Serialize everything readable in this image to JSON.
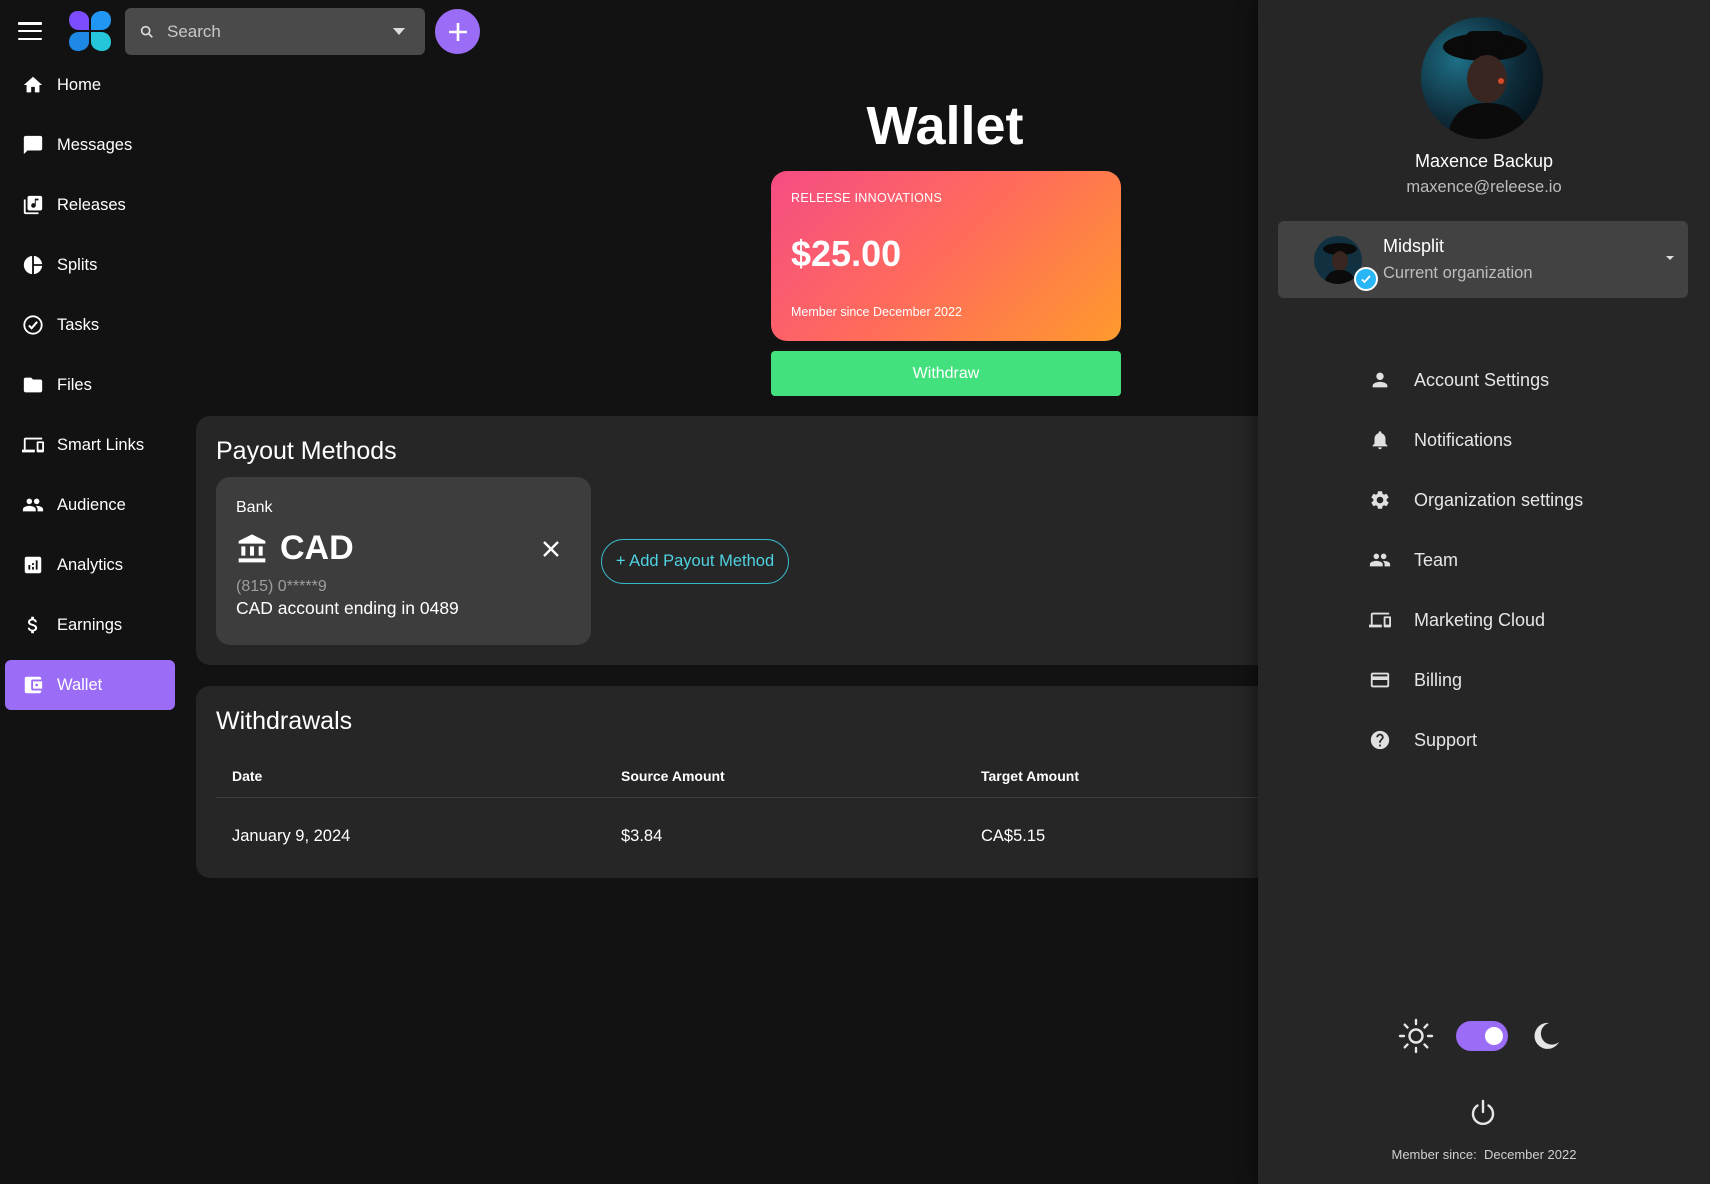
{
  "search": {
    "placeholder": "Search"
  },
  "sidebar": {
    "items": [
      {
        "label": "Home",
        "icon": "home-icon"
      },
      {
        "label": "Messages",
        "icon": "chat-icon"
      },
      {
        "label": "Releases",
        "icon": "music-library-icon"
      },
      {
        "label": "Splits",
        "icon": "pie-chart-icon"
      },
      {
        "label": "Tasks",
        "icon": "check-circle-icon"
      },
      {
        "label": "Files",
        "icon": "folder-icon"
      },
      {
        "label": "Smart Links",
        "icon": "devices-icon"
      },
      {
        "label": "Audience",
        "icon": "people-icon"
      },
      {
        "label": "Analytics",
        "icon": "analytics-icon"
      },
      {
        "label": "Earnings",
        "icon": "dollar-icon"
      },
      {
        "label": "Wallet",
        "icon": "wallet-icon",
        "active": true
      }
    ]
  },
  "main": {
    "title": "Wallet",
    "card": {
      "company": "RELEESE INNOVATIONS",
      "amount": "$25.00",
      "since": "Member since December 2022"
    },
    "withdraw_label": "Withdraw",
    "payout": {
      "title": "Payout Methods",
      "bank": {
        "type": "Bank",
        "currency": "CAD",
        "phone": "(815) 0*****9",
        "description": "CAD account ending in 0489"
      },
      "add_label": "+ Add Payout Method"
    },
    "withdrawals": {
      "title": "Withdrawals",
      "columns": [
        "Date",
        "Source Amount",
        "Target Amount"
      ],
      "rows": [
        [
          "January 9, 2024",
          "$3.84",
          "CA$5.15"
        ]
      ]
    }
  },
  "drawer": {
    "name": "Maxence Backup",
    "email": "maxence@releese.io",
    "org": {
      "name": "Midsplit",
      "subtitle": "Current organization"
    },
    "menu": [
      {
        "label": "Account Settings",
        "icon": "person-icon"
      },
      {
        "label": "Notifications",
        "icon": "bell-icon"
      },
      {
        "label": "Organization settings",
        "icon": "gear-icon"
      },
      {
        "label": "Team",
        "icon": "team-icon"
      },
      {
        "label": "Marketing Cloud",
        "icon": "devices-icon"
      },
      {
        "label": "Billing",
        "icon": "credit-card-icon"
      },
      {
        "label": "Support",
        "icon": "help-icon"
      }
    ],
    "theme": {
      "dark_mode": true
    },
    "member_since": "Member since:  December 2022"
  },
  "colors": {
    "accent": "#9b6cf5",
    "withdraw": "#43e07e",
    "link": "#4fd3e2",
    "background": "#121212",
    "panel": "#262626"
  }
}
